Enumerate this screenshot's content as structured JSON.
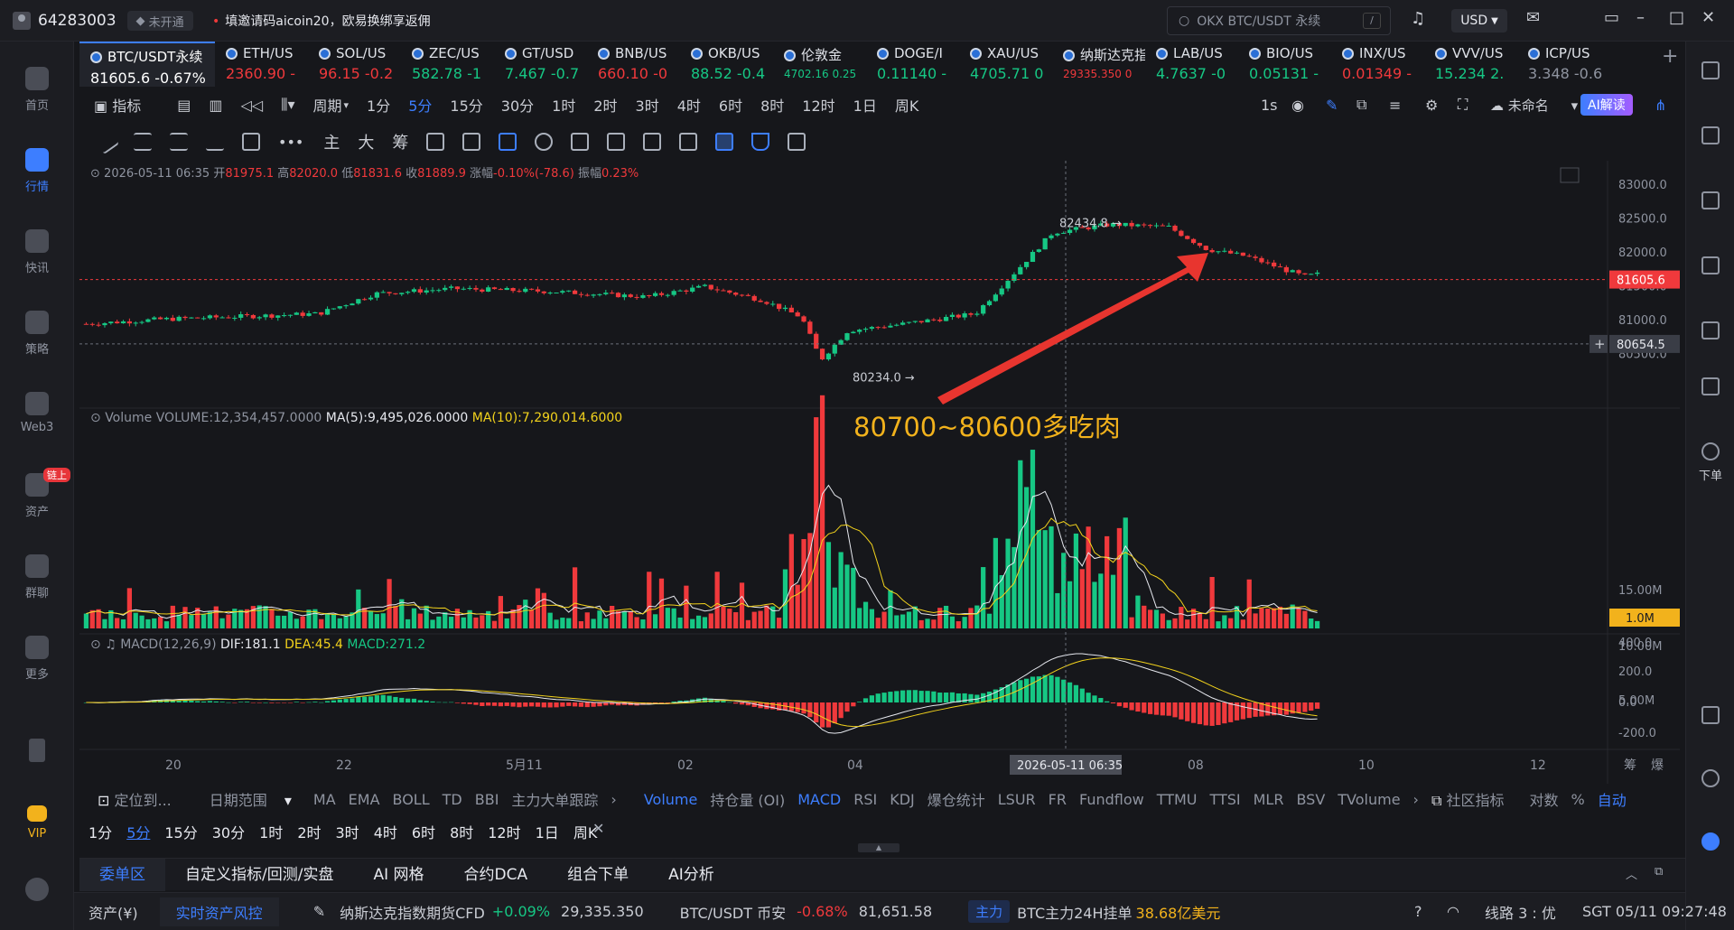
{
  "titlebar": {
    "user_id": "64283003",
    "vip_status": "未开通",
    "promo": "填邀请码aicoin20，欧易换绑享返佣",
    "search_placeholder": "OKX BTC/USDT 永续",
    "search_shortcut": "/",
    "currency": "USD"
  },
  "sidebar": {
    "items": [
      {
        "label": "首页",
        "icon": "home-icon"
      },
      {
        "label": "行情",
        "icon": "chart-bars-icon",
        "active": true
      },
      {
        "label": "快讯",
        "icon": "news-icon"
      },
      {
        "label": "策略",
        "icon": "robot-icon"
      },
      {
        "label": "Web3",
        "icon": "web3-icon"
      },
      {
        "label": "资产",
        "icon": "wallet-icon",
        "badge": "链上"
      },
      {
        "label": "群聊",
        "icon": "chat-icon"
      },
      {
        "label": "更多",
        "icon": "grid-icon"
      },
      {
        "label": "",
        "icon": "phone-icon"
      },
      {
        "label": "VIP",
        "icon": "diamond-icon"
      },
      {
        "label": "",
        "icon": "settings-icon"
      }
    ]
  },
  "rightbar": {
    "order_label": "下单"
  },
  "tickers": [
    {
      "name": "BTC/USDT永续",
      "price": "81605.6",
      "change": "-0.67%",
      "dir": "down",
      "active": true
    },
    {
      "name": "ETH/US",
      "price": "2360.90",
      "change": "-",
      "dir": "down"
    },
    {
      "name": "SOL/US",
      "price": "96.15",
      "change": "-0.2",
      "dir": "down"
    },
    {
      "name": "ZEC/US",
      "price": "582.78",
      "change": "-1",
      "dir": "up"
    },
    {
      "name": "GT/USD",
      "price": "7.467",
      "change": "-0.7",
      "dir": "up"
    },
    {
      "name": "BNB/US",
      "price": "660.10",
      "change": "-0",
      "dir": "down"
    },
    {
      "name": "OKB/US",
      "price": "88.52",
      "change": "-0.4",
      "dir": "up"
    },
    {
      "name": "伦敦金",
      "price": "4702.16",
      "change": "0.25",
      "dir": "up",
      "small": true
    },
    {
      "name": "DOGE/I",
      "price": "0.11140",
      "change": "-",
      "dir": "up"
    },
    {
      "name": "XAU/US",
      "price": "4705.71",
      "change": "0",
      "dir": "up"
    },
    {
      "name": "纳斯达克指",
      "price": "29335.350",
      "change": "0",
      "dir": "down",
      "small": true
    },
    {
      "name": "LAB/US",
      "price": "4.7637",
      "change": "-0",
      "dir": "up"
    },
    {
      "name": "BIO/US",
      "price": "0.05131",
      "change": "-",
      "dir": "up"
    },
    {
      "name": "INX/US",
      "price": "0.01349",
      "change": "-",
      "dir": "down"
    },
    {
      "name": "VVV/US",
      "price": "15.234",
      "change": "2.",
      "dir": "up"
    },
    {
      "name": "ICP/US",
      "price": "3.348",
      "change": "-0.6",
      "dir": "gray"
    }
  ],
  "toolbar1": {
    "items": [
      "指标",
      "周期",
      "1分",
      "5分",
      "15分",
      "30分",
      "1时",
      "2时",
      "3时",
      "4时",
      "6时",
      "8时",
      "12时",
      "1日",
      "周K"
    ],
    "selected": "5分",
    "right": {
      "interval": "1s",
      "layout_name": "未命名",
      "ai_button": "AI解读"
    }
  },
  "toolbar2": {
    "text_tools": [
      "主",
      "大",
      "筹"
    ]
  },
  "ohlc": {
    "datetime": "2026-05-11 06:35",
    "open_label": "开",
    "open": "81975.1",
    "high_label": "高",
    "high": "82020.0",
    "low_label": "低",
    "low": "81831.6",
    "close_label": "收",
    "close": "81889.9",
    "change_label": "涨幅",
    "change": "-0.10%(-78.6)",
    "amp_label": "振幅",
    "amp": "0.23%"
  },
  "volume_info": {
    "label": "Volume",
    "volume": "VOLUME:12,354,457.0000",
    "ma5": "MA(5):9,495,026.0000",
    "ma10": "MA(10):7,290,014.6000"
  },
  "macd_info": {
    "label": "MACD(12,26,9)",
    "dif": "DIF:181.1",
    "dea": "DEA:45.4",
    "macd": "MACD:271.2"
  },
  "annotation": "80700~80600多吃肉",
  "price_axis": [
    "83000.0",
    "82500.0",
    "82000.0",
    "81500.0",
    "81000.0",
    "80500.0"
  ],
  "current_price_tag": "81605.6",
  "crosshair_price_tag": "80654.5",
  "high_marker": "82434.8",
  "low_marker": "80234.0",
  "volume_axis": [
    "15.00M",
    "10.00M",
    "5.00M"
  ],
  "volume_tag": "1.0M",
  "macd_axis": [
    "400.0",
    "200.0",
    "0.0",
    "-200.0"
  ],
  "time_axis": [
    "20",
    "22",
    "5月11",
    "02",
    "04",
    "08",
    "10",
    "12"
  ],
  "time_cursor": "2026-05-11 06:35",
  "axis_corner": [
    "筹",
    "爆"
  ],
  "indicator_bar": {
    "locate": "定位到...",
    "date_range": "日期范围",
    "main": [
      "MA",
      "EMA",
      "BOLL",
      "TD",
      "BBI",
      "主力大单跟踪"
    ],
    "sub": [
      "Volume",
      "持仓量 (OI)",
      "MACD",
      "RSI",
      "KDJ",
      "爆仓统计",
      "LSUR",
      "FR",
      "Fundflow",
      "TTMU",
      "TTSI",
      "MLR",
      "BSV",
      "TVolume"
    ],
    "sub_selected": [
      "Volume",
      "MACD"
    ],
    "community": "社区指标",
    "log": "对数",
    "pct": "%",
    "auto": "自动"
  },
  "tf_bar": {
    "items": [
      "1分",
      "5分",
      "15分",
      "30分",
      "1时",
      "2时",
      "3时",
      "4时",
      "6时",
      "8时",
      "12时",
      "1日",
      "周K"
    ],
    "selected": "5分"
  },
  "bottom_tabs": [
    "委单区",
    "自定义指标/回测/实盘",
    "AI 网格",
    "合约DCA",
    "组合下单",
    "AI分析"
  ],
  "status": {
    "assets": "资产(¥)",
    "risk": "实时资产风控",
    "nasdaq_name": "纳斯达克指数期货CFD",
    "nasdaq_change": "+0.09%",
    "nasdaq_price": "29,335.350",
    "btc_name": "BTC/USDT 币安",
    "btc_change": "-0.68%",
    "btc_price": "81,651.58",
    "main_badge": "主力",
    "main_text": "BTC主力24H挂单",
    "main_value": "38.68亿美元",
    "line": "线路 3 : 优",
    "clock": "SGT 05/11 09:27:48"
  },
  "colors": {
    "up": "#16c784",
    "down": "#f0393c",
    "accent": "#3d7eff",
    "annotation": "#f2b21c",
    "ma5": "#e6e8ee",
    "ma10": "#f2d21c"
  }
}
